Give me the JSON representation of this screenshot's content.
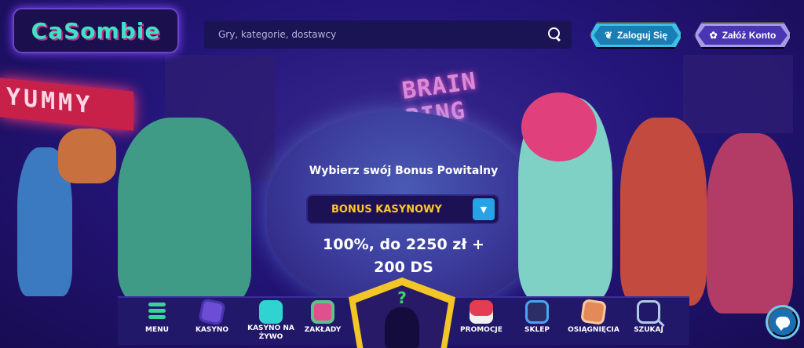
{
  "header": {
    "logo_text": "CaSombie",
    "search": {
      "placeholder": "Gry, kategorie, dostawcy",
      "icon": "search-icon"
    },
    "login_label": "Zaloguj Się",
    "login_icon": "brain-icon",
    "register_label": "Załóż Konto",
    "register_icon": "paw-icon"
  },
  "background": {
    "sign_left": "YUMMY",
    "sign_center": "BRAIN RING"
  },
  "hero": {
    "title": "Wybierz swój Bonus Powitalny",
    "bonus_select": {
      "selected": "BONUS KASYNOWY",
      "icon": "chevron-down-icon"
    },
    "offer_line1": "100%, do 2250 zł +",
    "offer_line2": "200 DS"
  },
  "bottom_nav": {
    "items": [
      {
        "label": "MENU",
        "icon": "menu-icon"
      },
      {
        "label": "KASYNO",
        "icon": "dice-icon"
      },
      {
        "label": "KASYNO NA ŻYWO",
        "icon": "bowtie-icon"
      },
      {
        "label": "ZAKŁADY",
        "icon": "ball-icon"
      },
      {
        "label": "PROMOCJE",
        "icon": "gift-icon"
      },
      {
        "label": "SKLEP",
        "icon": "skull-icon"
      },
      {
        "label": "OSIĄGNIĘCIA",
        "icon": "box-icon"
      },
      {
        "label": "SZUKAJ",
        "icon": "magnifier-icon"
      }
    ],
    "center_mark": "?"
  },
  "chat": {
    "icon": "chat-icon"
  },
  "colors": {
    "accent_yellow": "#f2c626",
    "bonus_text": "#ffc72e",
    "login_button": "#1a7eb6",
    "register_button": "#4a36b5",
    "menu_green": "#38d49a"
  }
}
